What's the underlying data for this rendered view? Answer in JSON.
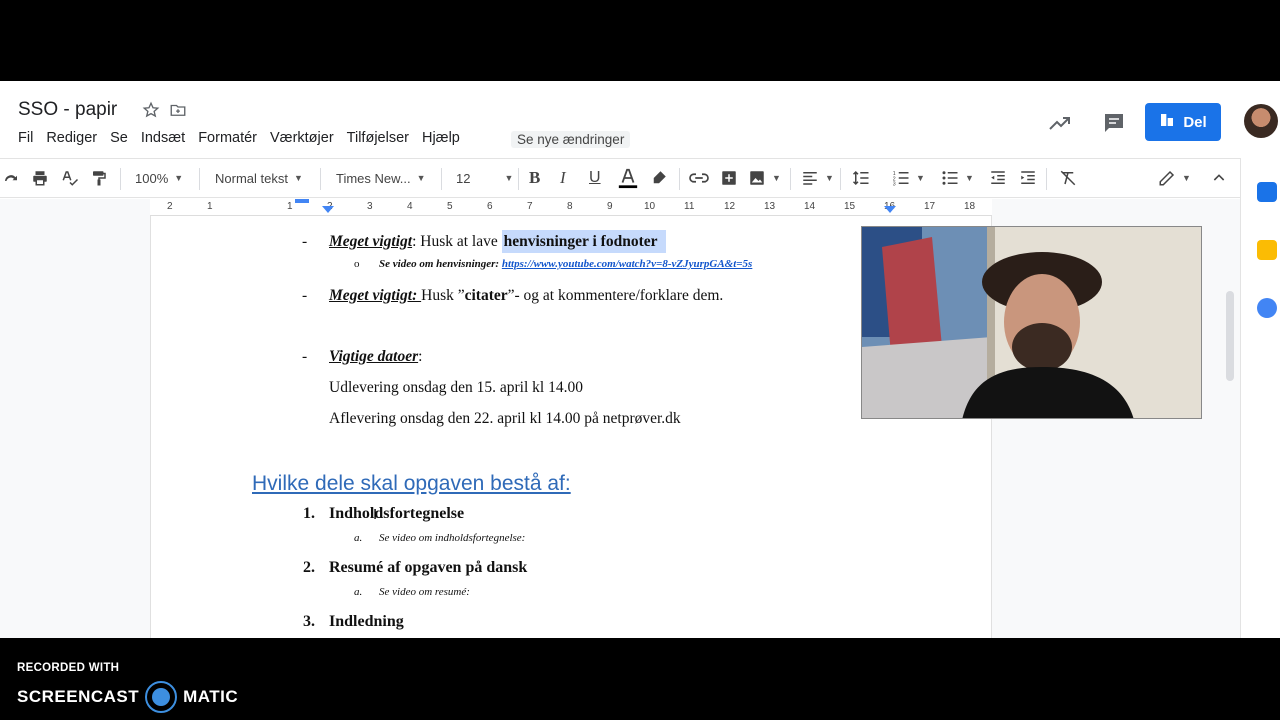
{
  "title": "SSO - papir",
  "menu": [
    "Fil",
    "Rediger",
    "Se",
    "Indsæt",
    "Formatér",
    "Værktøjer",
    "Tilføjelser",
    "Hjælp"
  ],
  "changes_label": "Se nye ændringer",
  "share_label": "Del",
  "toolbar": {
    "zoom": "100%",
    "style": "Normal tekst",
    "font": "Times New...",
    "size": "12"
  },
  "ruler": [
    "2",
    "1",
    "1",
    "2",
    "3",
    "4",
    "5",
    "6",
    "7",
    "8",
    "9",
    "10",
    "11",
    "12",
    "13",
    "14",
    "15",
    "16",
    "17",
    "18"
  ],
  "doc": {
    "b1_em": "Meget vigtigt",
    "b1_colon": ":",
    "b1_text": " Husk at lave ",
    "b1_hl": "henvisninger i fodnoter",
    "b1_sub_label": "Se video om henvisninger: ",
    "b1_sub_link": "https://www.youtube.com/watch?v=8-vZJyurpGA&t=5s",
    "b2_em": "Meget vigtigt: ",
    "b2_text1": "Husk ”",
    "b2_bold": "citater",
    "b2_text2": "”- og at kommentere/forklare dem.",
    "b3_em": "Vigtige datoer",
    "b3_colon": ":",
    "date1": "Udlevering onsdag den 15. april kl 14.00",
    "date2": "Aflevering onsdag den 22. april kl 14.00 på netprøver.dk",
    "heading": "Hvilke dele skal opgaven bestå af:",
    "items": [
      {
        "num": "1.",
        "label": "Indholdsfortegnelse",
        "sub": "Se video om indholdsfortegnelse:"
      },
      {
        "num": "2.",
        "label": "Resumé af opgaven på dansk",
        "sub": "Se video om resumé:"
      },
      {
        "num": "3.",
        "label": "Indledning"
      }
    ],
    "dash": "-",
    "circle": "o",
    "sub_letter": "a."
  },
  "footer": {
    "recorded": "RECORDED WITH",
    "brand_left": "SCREENCAST",
    "brand_right": "MATIC"
  },
  "colors": {
    "share": "#1a73e8",
    "heading": "#2f6ab8",
    "link": "#1155cc",
    "highlight": "#c6dafc"
  }
}
